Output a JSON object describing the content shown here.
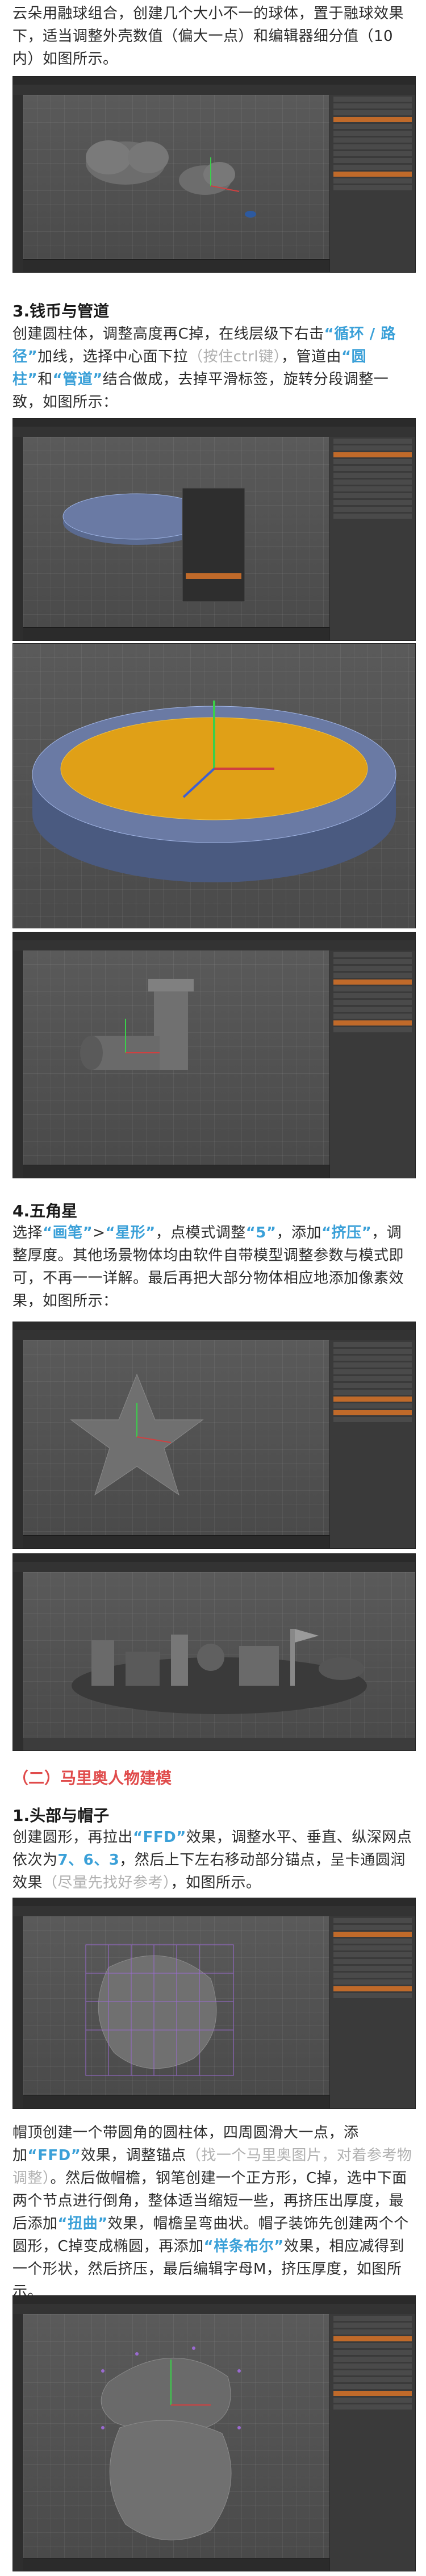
{
  "intro": {
    "text": "云朵用融球组合，创建几个大小不一的球体，置于融球效果下，适当调整外壳数值（偏大一点）和编辑器细分值（10内）如图所示。"
  },
  "coin": {
    "heading": "3.钱币与管道",
    "p1": "创建圆柱体，调整高度再C掉，在线层级下右击",
    "hl1": "“循环 / 路径”",
    "p2": "加线，选择中心面下拉",
    "hl2": "（按住ctrl键）",
    "p3": "，管道由",
    "hl3": "“圆柱”",
    "p4": "和",
    "hl4": "“管道”",
    "p5": "结合做成，去掉平滑标签，旋转分段调整一致，如图所示："
  },
  "star": {
    "heading": "4.五角星",
    "p1": "选择",
    "hl1": "“画笔”",
    "p2": ">",
    "hl2": "“星形”",
    "p3": "，点模式调整",
    "hl3": "“5”",
    "p4": "，添加",
    "hl4": "“挤压”",
    "p5": "，调整厚度。其他场景物体均由软件自带模型调整参数与模式即可，不再一一详解。最后再把大部分物体相应地添加像素效果，如图所示："
  },
  "mario_section": {
    "title": "（二）马里奥人物建模"
  },
  "head": {
    "heading": "1.头部与帽子",
    "p1": "创建圆形，再拉出",
    "hl1": "“FFD”",
    "p2": "效果，调整水平、垂直、纵深网点依次为",
    "hl2": "7、6、3",
    "p3": "，然后上下左右移动部分锚点，呈卡通圆润效果",
    "hl3": "（尽量先找好参考）",
    "p4": "，如图所示。"
  },
  "hat": {
    "p1": "帽顶创建一个带圆角的圆柱体，四周圆滑大一点，添加",
    "hl1": "“FFD”",
    "p2": "效果，调整锚点",
    "hl2": "（找一个马里奥图片，对着参考物调整）",
    "p3": "。然后做帽檐，钢笔创建一个正方形，C掉，选中下面两个节点进行倒角，整体适当缩短一些，再挤压出厚度，最后添加",
    "hl3": "“扭曲”",
    "p4": "效果，帽檐呈弯曲状。帽子装饰先创建两个个圆形，C掉变成椭圆，再添加",
    "hl4": "“样条布尔”",
    "p5": "效果，相应减得到一个形状，然后挤压，最后编辑字母M，挤压厚度，如图所示。"
  },
  "colors": {
    "highlight": "#3aa0d8",
    "muted": "#b0b0b0",
    "section": "#e04b4b",
    "coin_face": "#e0a017"
  }
}
